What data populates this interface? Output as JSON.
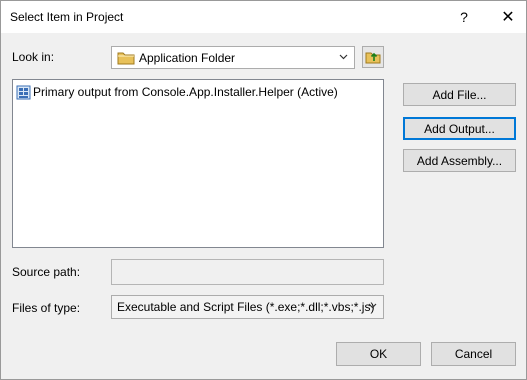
{
  "window": {
    "title": "Select Item in Project",
    "help_label": "?",
    "close_label": "✕"
  },
  "look_in": {
    "label": "Look in:",
    "value": "Application Folder"
  },
  "list": {
    "items": [
      {
        "label": "Primary output from Console.App.Installer.Helper (Active)"
      }
    ]
  },
  "buttons": {
    "add_file": "Add File...",
    "add_output": "Add Output...",
    "add_assembly": "Add Assembly...",
    "ok": "OK",
    "cancel": "Cancel"
  },
  "source_path": {
    "label": "Source path:",
    "value": ""
  },
  "files_of_type": {
    "label": "Files of type:",
    "value": "Executable and Script Files (*.exe;*.dll;*.vbs;*.js)"
  },
  "colors": {
    "default_button_border": "#0078d7",
    "folder_icon": "#e8c15a"
  },
  "icons": [
    "help-icon",
    "close-icon",
    "folder-icon",
    "chevron-down-icon",
    "folder-up-icon",
    "project-output-icon"
  ]
}
